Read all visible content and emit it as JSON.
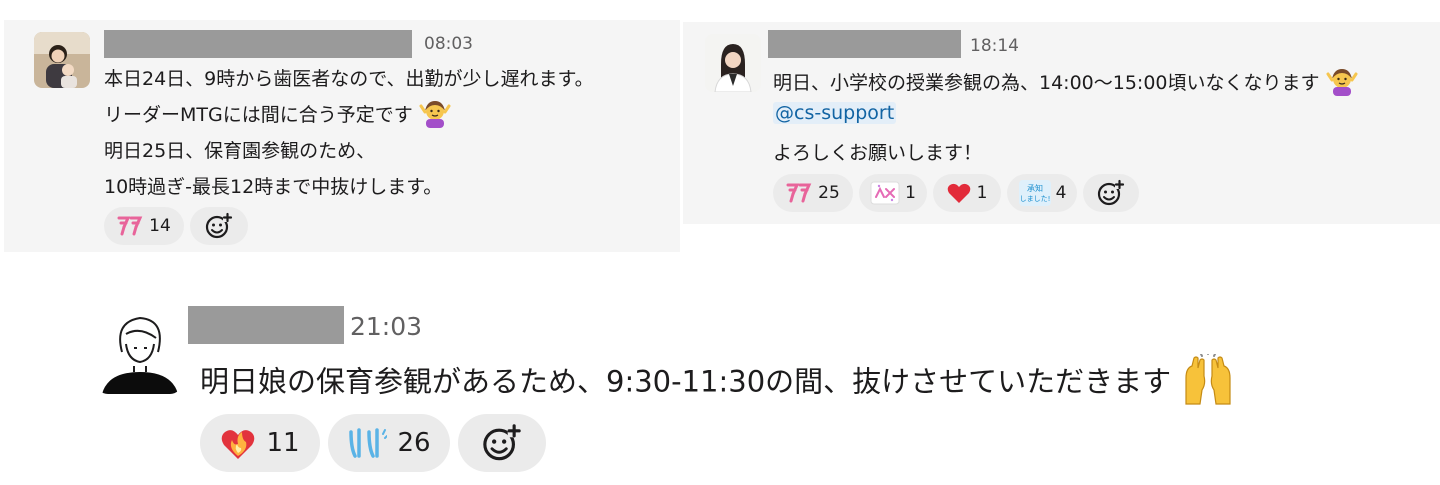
{
  "messages": [
    {
      "time": "08:03",
      "lines": [
        "本日24日、9時から歯医者なので、出勤が少し遅れます。",
        "リーダーMTGには間に合う予定です",
        "明日25日、保育園参観のため、",
        "10時過ぎ-最長12時まで中抜けします。"
      ],
      "reactions": [
        {
          "icon": "ryokai-icon",
          "count": "14"
        }
      ],
      "add_reaction_icon": "add-reaction-icon"
    },
    {
      "time": "18:14",
      "lines": [
        "明日、小学校の授業参観の為、14:00〜15:00頃いなくなります",
        "よろしくお願いします！"
      ],
      "mention": "@cs-support",
      "reactions": [
        {
          "icon": "ryokai-icon",
          "count": "25"
        },
        {
          "icon": "sparkle-stamp-icon",
          "count": "1"
        },
        {
          "icon": "red-heart-icon",
          "count": "1"
        },
        {
          "icon": "shochi-shimashita-icon",
          "count": "4",
          "stamp_text": [
            "承知",
            "しました!"
          ]
        }
      ],
      "add_reaction_icon": "add-reaction-icon"
    },
    {
      "time": "21:03",
      "lines": [
        "明日娘の保育参観があるため、9:30-11:30の間、抜けさせていただきます"
      ],
      "reactions": [
        {
          "icon": "heart-on-fire-icon",
          "count": "11"
        },
        {
          "icon": "hai-hai-icon",
          "count": "26"
        }
      ],
      "add_reaction_icon": "add-reaction-icon"
    }
  ],
  "colors": {
    "card_bg": "#f5f5f5",
    "reaction_bg": "#ebebeb",
    "redaction": "#9a9a9a",
    "mention_bg": "#e3eef8",
    "mention_text": "#1264a3",
    "ryokai_pink": "#e8649a",
    "hai_blue": "#5ab3e6"
  }
}
